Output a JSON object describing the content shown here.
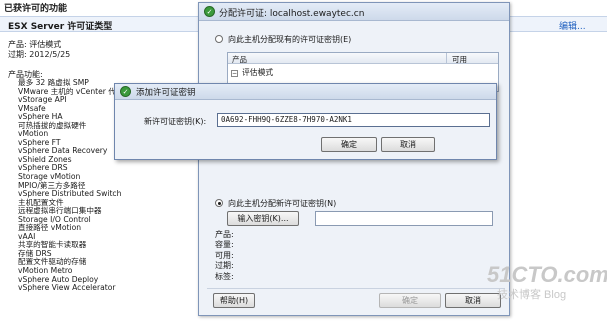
{
  "background": {
    "section_title": "已获许可的功能",
    "subheader": "ESX Server 许可证类型",
    "edit_link": "编辑...",
    "product_line": "产品: 评估模式",
    "expires_line": "过期: 2012/5/25",
    "features_title": "产品功能:",
    "features": [
      "最多 32 路虚拟 SMP",
      "VMware 主机的 vCenter 代理",
      "vStorage API",
      "VMsafe",
      "vSphere HA",
      "可热插拔的虚拟硬件",
      "vMotion",
      "vSphere FT",
      "vSphere Data Recovery",
      "vShield Zones",
      "vSphere DRS",
      "Storage vMotion",
      "MPIO/第三方多路径",
      "vSphere Distributed Switch",
      "主机配置文件",
      "远程虚拟串行端口集中器",
      "Storage I/O Control",
      "直接路径 vMotion",
      "vAAI",
      "共享的智能卡读取器",
      "存储 DRS",
      "配置文件驱动的存储",
      "vMotion Metro",
      "vSphere Auto Deploy",
      "vSphere View Accelerator"
    ]
  },
  "dialog": {
    "title": "分配许可证: localhost.ewaytec.cn",
    "option_existing": "向此主机分配现有的许可证密钥(E)",
    "table_headers": [
      "产品",
      "可用"
    ],
    "table_row": "评估模式",
    "option_new": "向此主机分配新许可证密钥(N)",
    "enter_key_button": "输入密钥(K)...",
    "detail_labels": [
      "产品:",
      "容量:",
      "可用:",
      "过期:",
      "标签:"
    ],
    "help_button": "帮助(H)",
    "ok_button": "确定",
    "cancel_button": "取消"
  },
  "key_dialog": {
    "title": "添加许可证密钥",
    "field_label": "新许可证密钥(K):",
    "field_value": "0A692-FHH9Q-6ZZE8-7H970-A2NK1",
    "ok_button": "确定",
    "cancel_button": "取消"
  },
  "watermark": {
    "brand": "51CTO.com",
    "tagline": "技术博客  Blog"
  }
}
